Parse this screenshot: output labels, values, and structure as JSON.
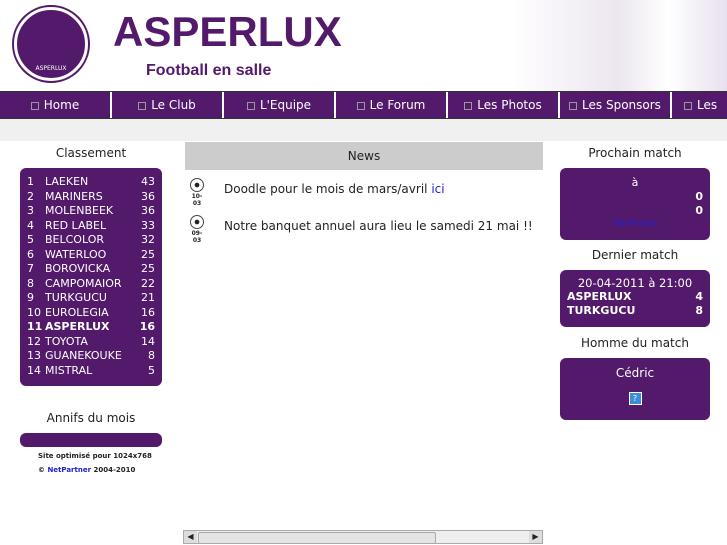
{
  "header": {
    "title": "ASPERLUX",
    "subtitle": "Football en salle",
    "logo_text": "ASPERLUX"
  },
  "nav": [
    "Home",
    "Le Club",
    "L'Equipe",
    "Le Forum",
    "Les Photos",
    "Les Sponsors",
    "Les"
  ],
  "classement": {
    "title": "Classement",
    "rows": [
      [
        "1",
        "LAEKEN",
        "43"
      ],
      [
        "2",
        "MARINERS",
        "36"
      ],
      [
        "3",
        "MOLENBEEK",
        "36"
      ],
      [
        "4",
        "RED LABEL",
        "33"
      ],
      [
        "5",
        "BELCOLOR",
        "32"
      ],
      [
        "6",
        "WATERLOO",
        "25"
      ],
      [
        "7",
        "BOROVICKA",
        "25"
      ],
      [
        "8",
        "CAMPOMAIOR",
        "22"
      ],
      [
        "9",
        "TURKGUCU",
        "21"
      ],
      [
        "10",
        "EUROLEGIA",
        "16"
      ],
      [
        "11",
        "ASPERLUX",
        "16"
      ],
      [
        "12",
        "TOYOTA",
        "14"
      ],
      [
        "13",
        "GUANEKOUKE",
        "8"
      ],
      [
        "14",
        "MISTRAL",
        "5"
      ]
    ]
  },
  "annifs": {
    "title": "Annifs du mois"
  },
  "footer": {
    "optimise": "Site optimisé pour 1024x768",
    "copy": "©",
    "partner": "NetPartner",
    "years": "2004-2010"
  },
  "news": {
    "title": "News",
    "items": [
      {
        "date": "10-03",
        "text": "Doodle pour le mois de mars/avril ",
        "link": "ici"
      },
      {
        "date": "09-03",
        "text": "Notre banquet annuel aura lieu le samedi 21 mai !!"
      }
    ]
  },
  "prochain": {
    "title": "Prochain match",
    "a": "à",
    "score1": "0",
    "score2": "0",
    "link": "Itinéraire"
  },
  "dernier": {
    "title": "Dernier match",
    "date": "20-04-2011 à 21:00",
    "team1": "ASPERLUX",
    "score1": "4",
    "team2": "TURKGUCU",
    "score2": "8"
  },
  "homme": {
    "title": "Homme du match",
    "name": "Cédric",
    "img": "?"
  }
}
